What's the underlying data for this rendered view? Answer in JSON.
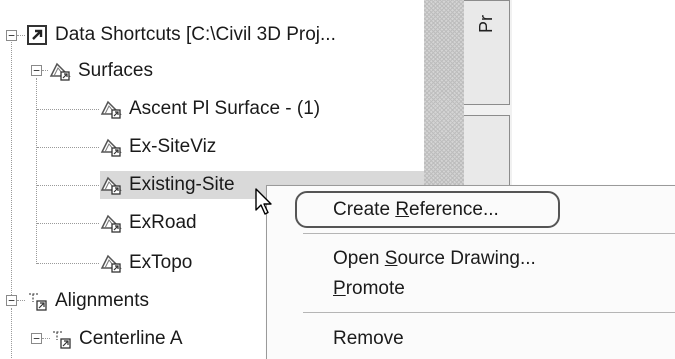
{
  "tree": {
    "root": {
      "label": "Data Shortcuts [C:\\Civil 3D Proj...",
      "expander": "−",
      "icon": "data-shortcuts-icon"
    },
    "surfaces_folder": {
      "label": "Surfaces",
      "expander": "−",
      "icon": "surface-folder-icon"
    },
    "surfaces": [
      {
        "label": "Ascent Pl Surface - (1)",
        "icon": "surface-icon"
      },
      {
        "label": "Ex-SiteViz",
        "icon": "surface-icon"
      },
      {
        "label": "Existing-Site",
        "icon": "surface-icon",
        "selected": true
      },
      {
        "label": "ExRoad",
        "icon": "surface-icon"
      },
      {
        "label": "ExTopo",
        "icon": "surface-icon"
      }
    ],
    "alignments_folder": {
      "label": "Alignments",
      "expander": "−",
      "icon": "alignment-folder-icon"
    },
    "alignments": [
      {
        "label": "Centerline A",
        "expander": "−",
        "icon": "alignment-icon"
      }
    ]
  },
  "side_tab": {
    "label": "Pr"
  },
  "context_menu": {
    "create_reference": {
      "before": "Create ",
      "accel": "R",
      "after": "eference..."
    },
    "open_source": {
      "before": "Open ",
      "accel": "S",
      "after": "ource Drawing..."
    },
    "promote": {
      "before": "",
      "accel": "P",
      "after": "romote"
    },
    "remove": {
      "label": "Remove"
    }
  },
  "colors": {
    "selection": "#d9d9d9",
    "menu_bg": "#fbfbfb",
    "callout": "#555555"
  },
  "cursor": "arrow-pointer-icon"
}
